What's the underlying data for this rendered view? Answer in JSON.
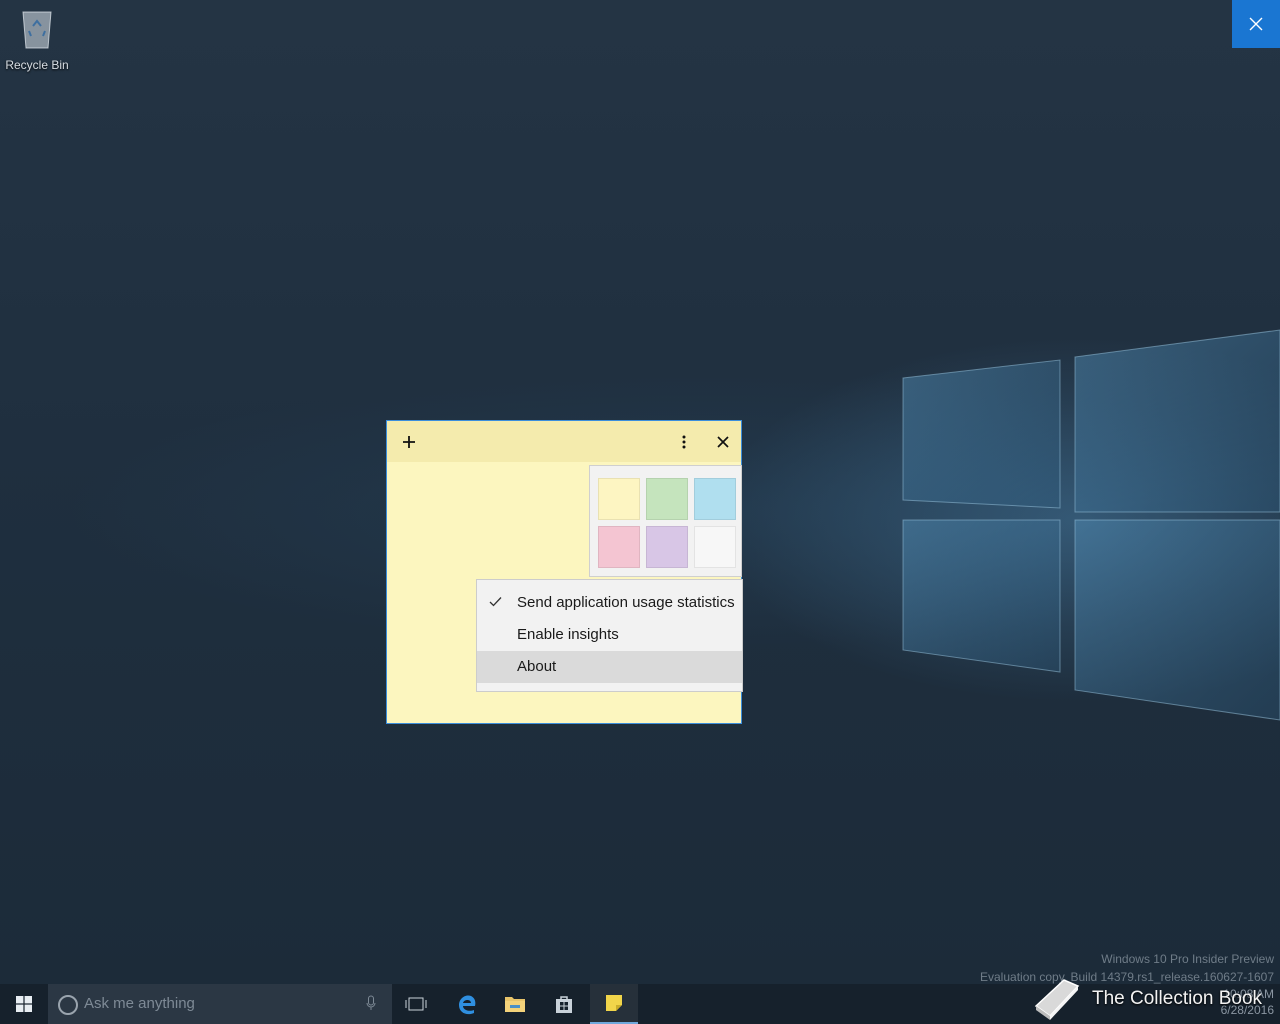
{
  "desktop": {
    "recycle_bin_label": "Recycle Bin",
    "watermark_line1": "Windows 10 Pro Insider Preview",
    "watermark_line2": "Evaluation copy. Build 14379.rs1_release.160627-1607"
  },
  "sticky_note": {
    "new_note_icon": "plus-icon",
    "menu_icon": "ellipsis-icon",
    "close_icon": "close-icon",
    "background_color": "#fcf6bf",
    "colors": [
      "#fdf5c2",
      "#c5e4bd",
      "#b0dfef",
      "#f4c5d2",
      "#d8c6e6",
      "#f7f7f7"
    ],
    "menu": {
      "items": [
        {
          "label": "Send application usage statistics",
          "checked": true
        },
        {
          "label": "Enable insights",
          "checked": false
        },
        {
          "label": "About",
          "checked": false,
          "highlighted": true
        }
      ]
    }
  },
  "taskbar": {
    "search_placeholder": "Ask me anything",
    "clock_time": "10:08 AM",
    "clock_date": "6/28/2016",
    "apps": [
      "task-view-icon",
      "edge-icon",
      "file-explorer-icon",
      "store-icon",
      "sticky-notes-icon"
    ]
  },
  "overlay": {
    "brand_name": "The Collection Book"
  },
  "accent_color": "#1a76d2"
}
